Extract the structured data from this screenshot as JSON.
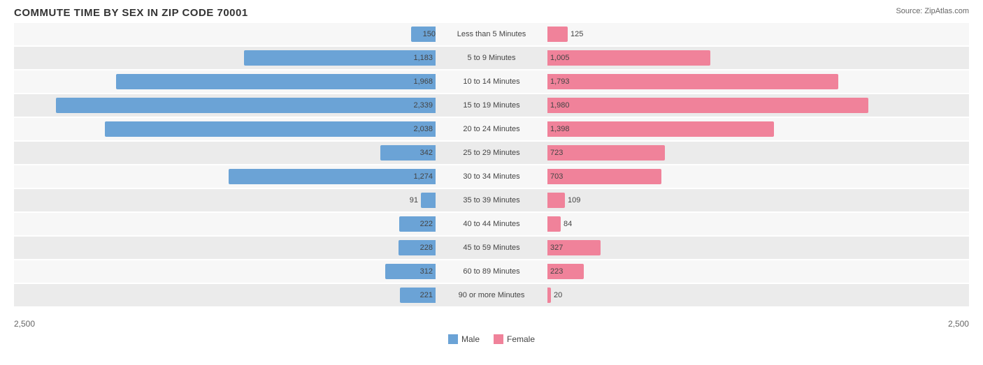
{
  "title": "COMMUTE TIME BY SEX IN ZIP CODE 70001",
  "source": "Source: ZipAtlas.com",
  "max_value": 2500,
  "colors": {
    "male": "#6ba3d6",
    "female": "#f0829a"
  },
  "legend": {
    "male_label": "Male",
    "female_label": "Female"
  },
  "axis": {
    "left": "2,500",
    "right": "2,500"
  },
  "rows": [
    {
      "label": "Less than 5 Minutes",
      "male": 150,
      "female": 125
    },
    {
      "label": "5 to 9 Minutes",
      "male": 1183,
      "female": 1005
    },
    {
      "label": "10 to 14 Minutes",
      "male": 1968,
      "female": 1793
    },
    {
      "label": "15 to 19 Minutes",
      "male": 2339,
      "female": 1980
    },
    {
      "label": "20 to 24 Minutes",
      "male": 2038,
      "female": 1398
    },
    {
      "label": "25 to 29 Minutes",
      "male": 342,
      "female": 723
    },
    {
      "label": "30 to 34 Minutes",
      "male": 1274,
      "female": 703
    },
    {
      "label": "35 to 39 Minutes",
      "male": 91,
      "female": 109
    },
    {
      "label": "40 to 44 Minutes",
      "male": 222,
      "female": 84
    },
    {
      "label": "45 to 59 Minutes",
      "male": 228,
      "female": 327
    },
    {
      "label": "60 to 89 Minutes",
      "male": 312,
      "female": 223
    },
    {
      "label": "90 or more Minutes",
      "male": 221,
      "female": 20
    }
  ]
}
